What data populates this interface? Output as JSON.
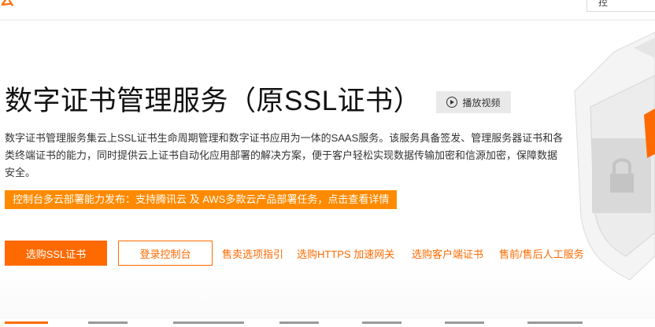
{
  "header": {
    "logo_fragment": "云",
    "top_box_label": "控"
  },
  "hero": {
    "title": "数字证书管理服务（原SSL证书）",
    "video_button": {
      "label": "播放视频",
      "icon": "play-circle-icon"
    },
    "description": "数字证书管理服务集云上SSL证书生命周期管理和数字证书应用为一体的SAAS服务。该服务具备签发、管理服务器证书和各类终端证书的能力，同时提供云上证书自动化应用部署的解决方案，便于客户轻松实现数据传输加密和信源加密，保障数据安全。",
    "notice": "控制台多云部署能力发布：支持腾讯云 及 AWS多款云产品部署任务，点击查看详情",
    "primary_button": "选购SSL证书",
    "secondary_button": "登录控制台",
    "links": [
      "售卖选项指引",
      "选购HTTPS 加速网关",
      "选购客户端证书",
      "售前/售后人工服务"
    ]
  },
  "colors": {
    "accent": "#ff6a00",
    "notice_bg": "#ff8a00",
    "title": "#111111"
  }
}
